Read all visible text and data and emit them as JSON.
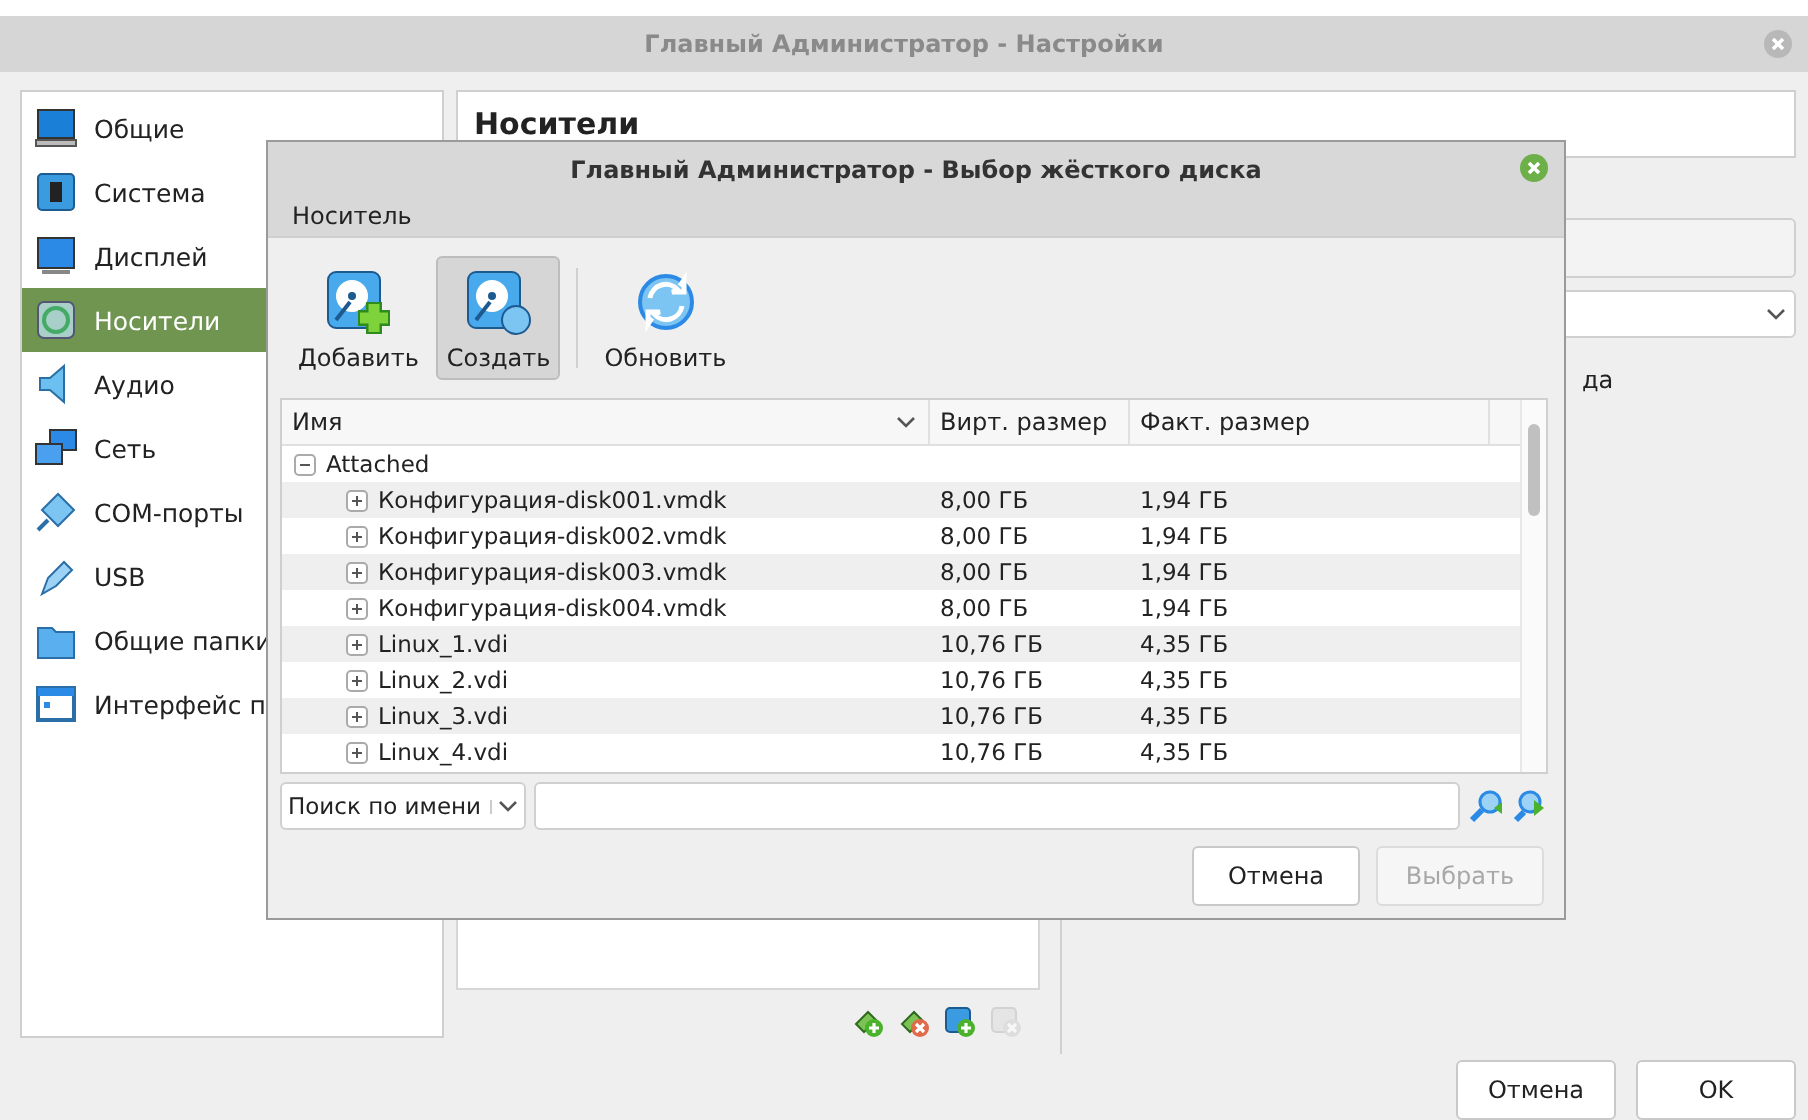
{
  "window": {
    "title": "Главный Администратор - Настройки"
  },
  "sidebar": {
    "items": [
      {
        "label": "Общие",
        "selected": false
      },
      {
        "label": "Система",
        "selected": false
      },
      {
        "label": "Дисплей",
        "selected": false
      },
      {
        "label": "Носители",
        "selected": true
      },
      {
        "label": "Аудио",
        "selected": false
      },
      {
        "label": "Сеть",
        "selected": false
      },
      {
        "label": "COM-порты",
        "selected": false
      },
      {
        "label": "USB",
        "selected": false
      },
      {
        "label": "Общие папки",
        "selected": false
      },
      {
        "label": "Интерфейс п",
        "selected": false
      }
    ]
  },
  "page": {
    "title": "Носители",
    "storage_tools": [
      {
        "kind": "add-controller",
        "disabled": false
      },
      {
        "kind": "remove-controller",
        "disabled": false
      },
      {
        "kind": "add-attachment",
        "disabled": false
      },
      {
        "kind": "remove-attachment",
        "disabled": true
      }
    ],
    "side_text": "да"
  },
  "buttons": [
    {
      "label": "Отмена"
    },
    {
      "label": "OK"
    }
  ],
  "dialog": {
    "title": "Главный Администратор - Выбор жёсткого диска",
    "menu": [
      "Носитель"
    ],
    "toolbar": [
      {
        "kind": "add",
        "label": "Добавить",
        "pressed": false
      },
      {
        "kind": "create",
        "label": "Создать",
        "pressed": true
      },
      {
        "kind": "refresh",
        "label": "Обновить",
        "pressed": false
      }
    ],
    "table": {
      "columns": [
        "Имя",
        "Вирт. размер",
        "Факт. размер"
      ],
      "rows": [
        {
          "name": "Attached",
          "expanded": true,
          "children": [
            {
              "name": "Конфигурация-disk001.vmdk",
              "virtual": "8,00 ГБ",
              "actual": "1,94 ГБ",
              "expanded": false
            },
            {
              "name": "Конфигурация-disk002.vmdk",
              "virtual": "8,00 ГБ",
              "actual": "1,94 ГБ",
              "expanded": false
            },
            {
              "name": "Конфигурация-disk003.vmdk",
              "virtual": "8,00 ГБ",
              "actual": "1,94 ГБ",
              "expanded": false
            },
            {
              "name": "Конфигурация-disk004.vmdk",
              "virtual": "8,00 ГБ",
              "actual": "1,94 ГБ",
              "expanded": false
            },
            {
              "name": "Linux_1.vdi",
              "virtual": "10,76 ГБ",
              "actual": "4,35 ГБ",
              "expanded": false
            },
            {
              "name": "Linux_2.vdi",
              "virtual": "10,76 ГБ",
              "actual": "4,35 ГБ",
              "expanded": false
            },
            {
              "name": "Linux_3.vdi",
              "virtual": "10,76 ГБ",
              "actual": "4,35 ГБ",
              "expanded": false
            },
            {
              "name": "Linux_4.vdi",
              "virtual": "10,76 ГБ",
              "actual": "4,35 ГБ",
              "expanded": false
            }
          ]
        }
      ]
    },
    "search": {
      "mode": "Поиск по имени"
    },
    "buttons": [
      {
        "label": "Отмена",
        "disabled": false
      },
      {
        "label": "Выбрать",
        "disabled": true
      }
    ]
  }
}
